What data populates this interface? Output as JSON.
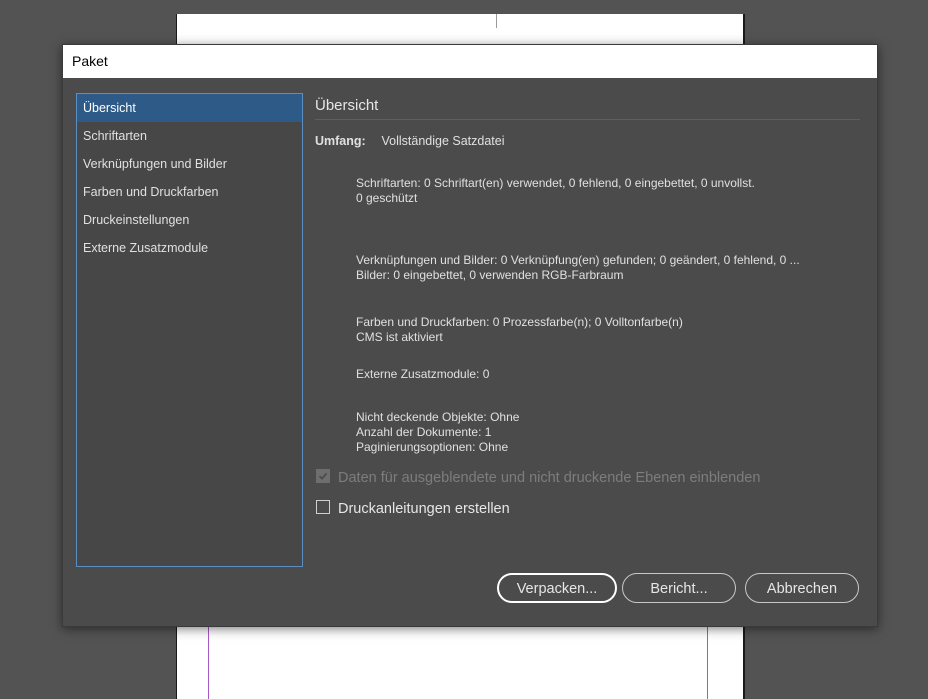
{
  "dialog": {
    "title": "Paket"
  },
  "sidebar": {
    "items": [
      {
        "label": "Übersicht",
        "selected": true
      },
      {
        "label": "Schriftarten"
      },
      {
        "label": "Verknüpfungen und Bilder"
      },
      {
        "label": "Farben und Druckfarben"
      },
      {
        "label": "Druckeinstellungen"
      },
      {
        "label": "Externe Zusatzmodule"
      }
    ]
  },
  "content": {
    "title": "Übersicht",
    "scope_label": "Umfang:",
    "scope_value": "Vollständige Satzdatei",
    "fonts": {
      "line1": "Schriftarten: 0 Schriftart(en) verwendet, 0 fehlend, 0 eingebettet, 0 unvollst.",
      "line2": "0 geschützt"
    },
    "links": {
      "line1": "Verknüpfungen und Bilder: 0 Verknüpfung(en) gefunden; 0 geändert, 0 fehlend, 0 ...",
      "line2": "Bilder: 0 eingebettet, 0 verwenden RGB-Farbraum"
    },
    "colors": {
      "line1": "Farben und Druckfarben: 0 Prozessfarbe(n); 0 Volltonfarbe(n)",
      "line2": "CMS ist aktiviert"
    },
    "plugins": {
      "line1": "Externe Zusatzmodule: 0"
    },
    "misc": {
      "line1": "Nicht deckende Objekte: Ohne",
      "line2": "Anzahl der Dokumente: 1",
      "line3": "Paginierungsoptionen: Ohne"
    },
    "checkbox_hidden_layers": {
      "label": "Daten für ausgeblendete und nicht druckende Ebenen einblenden",
      "checked": true,
      "disabled": true
    },
    "checkbox_instructions": {
      "label": "Druckanleitungen erstellen",
      "checked": false
    }
  },
  "buttons": {
    "pack": "Verpacken...",
    "report": "Bericht...",
    "cancel": "Abbrechen"
  },
  "colors": {
    "dialog_bg": "#4b4b4b",
    "app_bg": "#535353",
    "selection": "#2e5a87",
    "sidebar_border": "#5b8ec1"
  }
}
